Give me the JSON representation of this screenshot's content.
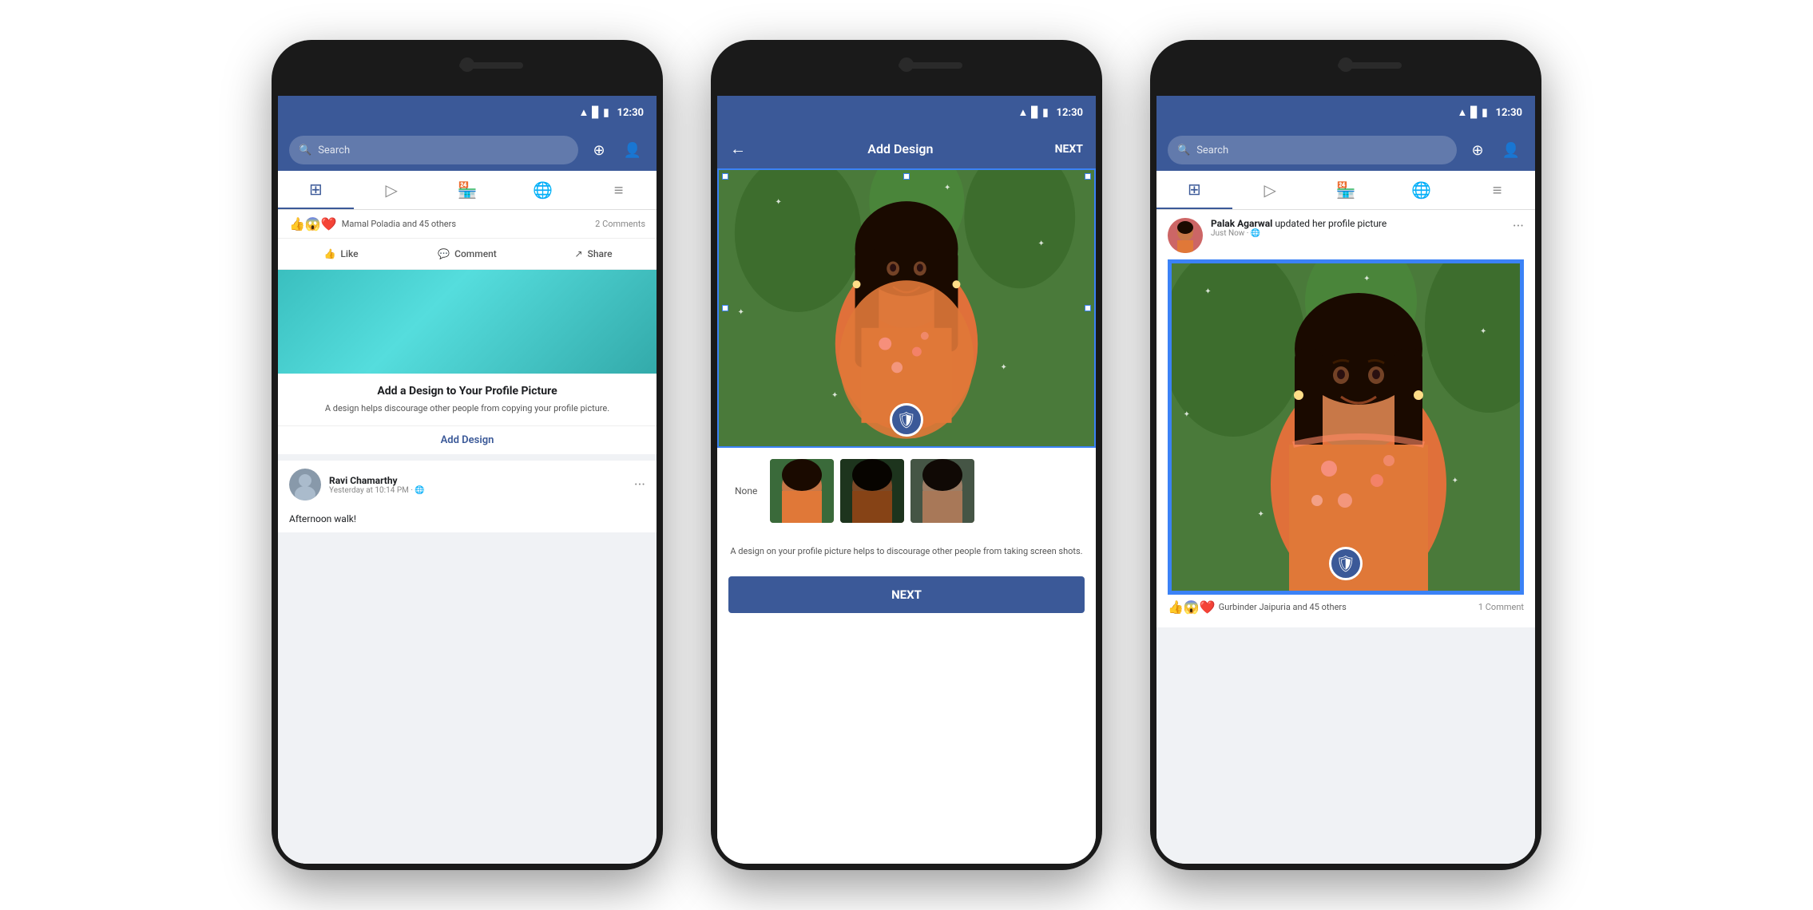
{
  "scene": {
    "bg_color": "#ffffff"
  },
  "phone1": {
    "status_time": "12:30",
    "search_placeholder": "Search",
    "tabs": [
      "news-feed",
      "video",
      "marketplace",
      "globe",
      "menu"
    ],
    "reactions": "👍😱❤️",
    "reactions_text": "Mamal Poladia and 45 others",
    "comments_count": "2 Comments",
    "actions": [
      "Like",
      "Comment",
      "Share"
    ],
    "feature_title": "Add a Design to Your Profile Picture",
    "feature_desc": "A design helps discourage other people from copying your profile picture.",
    "add_design_label": "Add Design",
    "poster_name": "Ravi Chamarthy",
    "poster_time": "Yesterday at 10:14 PM · 🌐",
    "poster_text": "Afternoon walk!"
  },
  "phone2": {
    "status_time": "12:30",
    "header_title": "Add Design",
    "next_label": "NEXT",
    "back_arrow": "←",
    "option_none": "None",
    "desc_text": "A design on your profile picture helps to discourage other people from taking screen shots.",
    "next_button_label": "NEXT"
  },
  "phone3": {
    "status_time": "12:30",
    "search_placeholder": "Search",
    "poster_name": "Palak Agarwal",
    "action_text": "updated her profile picture",
    "poster_time": "Just Now · 🌐",
    "reactions": "👍😱❤️",
    "reactions_text": "Gurbinder Jaipuria and 45 others",
    "comments_count": "1 Comment"
  }
}
